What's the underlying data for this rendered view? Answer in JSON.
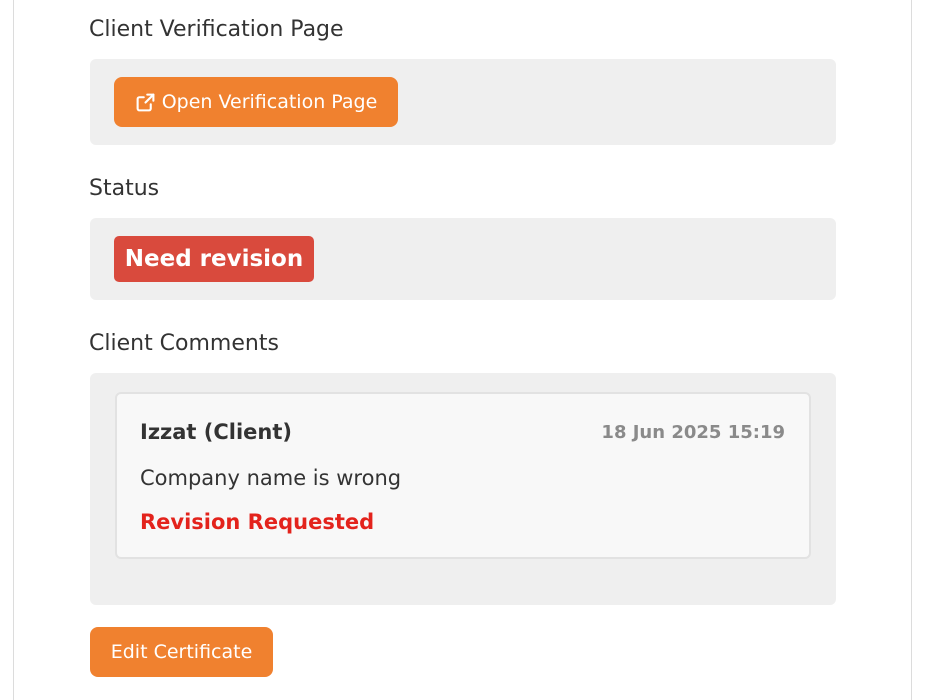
{
  "verification": {
    "label": "Client Verification Page",
    "button_label": "Open Verification Page",
    "button_icon": "external-link-icon"
  },
  "status": {
    "label": "Status",
    "badge": "Need revision",
    "badge_color": "#d94a3d"
  },
  "comments": {
    "label": "Client Comments",
    "items": [
      {
        "author": "Izzat (Client)",
        "timestamp": "18 Jun 2025 15:19",
        "text": "Company name is wrong",
        "flag": "Revision Requested",
        "flag_color": "#e3231c"
      }
    ]
  },
  "actions": {
    "edit_label": "Edit Certificate"
  },
  "colors": {
    "accent": "#f0812f",
    "panel_bg": "#efefef"
  }
}
